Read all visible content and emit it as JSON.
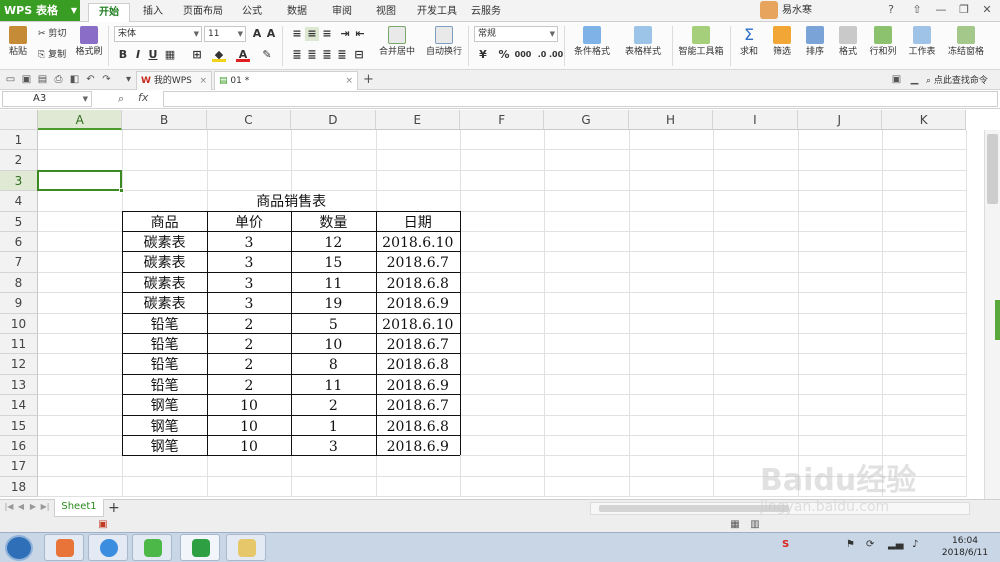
{
  "app": {
    "brand": "WPS 表格",
    "menu_tabs": [
      "开始",
      "插入",
      "页面布局",
      "公式",
      "数据",
      "审阅",
      "视图",
      "开发工具",
      "云服务"
    ],
    "active_menu": "开始",
    "user": "易水寒",
    "window_buttons": [
      "?",
      "⇧",
      "—",
      "❐",
      "✕"
    ]
  },
  "ribbon": {
    "paste": "粘贴",
    "cut": "剪切",
    "copy": "复制",
    "format_painter": "格式刷",
    "font_name": "宋体",
    "font_size": "11",
    "bold": "B",
    "italic": "I",
    "underline": "U",
    "merge_center": "合并居中",
    "wrap_text": "自动换行",
    "number_format": "常规",
    "percent": "%",
    "thousands": "000",
    "conditional_format": "条件格式",
    "table_style": "表格样式",
    "smart_toolbox": "智能工具箱",
    "sum": "求和",
    "filter": "筛选",
    "sort": "排序",
    "format": "格式",
    "rows_cols": "行和列",
    "worksheet": "工作表",
    "freeze_panes": "冻结窗格"
  },
  "doc_tabs": [
    {
      "label": "我的WPS",
      "active": false
    },
    {
      "label": "01 *",
      "active": true
    }
  ],
  "search_cmd": "点此查找命令",
  "formula_bar": {
    "name_box": "A3",
    "fx": "fx",
    "value": ""
  },
  "grid": {
    "columns": [
      "A",
      "B",
      "C",
      "D",
      "E",
      "F",
      "G",
      "H",
      "I",
      "J",
      "K"
    ],
    "selected_column": "A",
    "rows": [
      "1",
      "2",
      "3",
      "4",
      "5",
      "6",
      "7",
      "8",
      "9",
      "10",
      "11",
      "12",
      "13",
      "14",
      "15",
      "16",
      "17",
      "18"
    ],
    "selected_row": "3",
    "title": "商品销售表",
    "headers": [
      "商品",
      "单价",
      "数量",
      "日期"
    ],
    "data": [
      [
        "碳素表",
        "3",
        "12",
        "2018.6.10"
      ],
      [
        "碳素表",
        "3",
        "15",
        "2018.6.7"
      ],
      [
        "碳素表",
        "3",
        "11",
        "2018.6.8"
      ],
      [
        "碳素表",
        "3",
        "19",
        "2018.6.9"
      ],
      [
        "铅笔",
        "2",
        "5",
        "2018.6.10"
      ],
      [
        "铅笔",
        "2",
        "10",
        "2018.6.7"
      ],
      [
        "铅笔",
        "2",
        "8",
        "2018.6.8"
      ],
      [
        "铅笔",
        "2",
        "11",
        "2018.6.9"
      ],
      [
        "钢笔",
        "10",
        "2",
        "2018.6.7"
      ],
      [
        "钢笔",
        "10",
        "1",
        "2018.6.8"
      ],
      [
        "钢笔",
        "10",
        "3",
        "2018.6.9"
      ]
    ]
  },
  "sheet_tabs": [
    "Sheet1"
  ],
  "taskbar": {
    "clock_time": "16:04",
    "clock_date": "2018/6/11"
  },
  "watermark": "Baidu经验",
  "watermark_url": "jingyan.baidu.com",
  "colors": {
    "accent": "#3a9d23",
    "selection": "#3c8a22"
  }
}
